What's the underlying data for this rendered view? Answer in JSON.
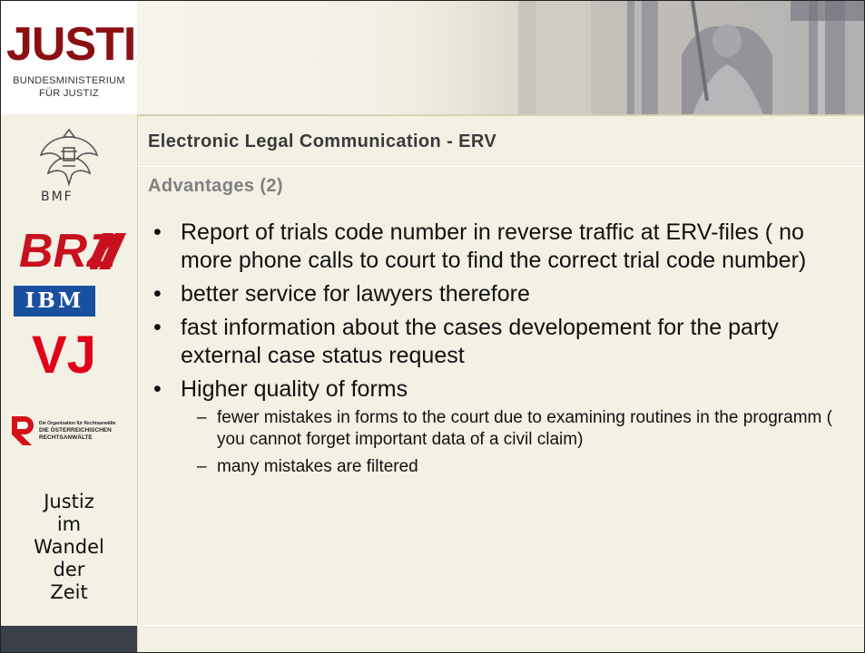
{
  "logos": {
    "justiz_wordmark": "JUSTIZ",
    "justiz_sub_line1": "BUNDESMINISTERIUM",
    "justiz_sub_line2": "FÜR JUSTIZ",
    "bmf_label": "BMF",
    "brz_label": "BRZ",
    "ibm_label": "IBM",
    "vj_label": "VJ",
    "rak_line1": "Die Organisation für Rechtsanwälte",
    "rak_line2": "DIE ÖSTERREICHISCHEN",
    "rak_line3": "RECHTSANWÄLTE"
  },
  "slide": {
    "title": "Electronic Legal Communication - ERV",
    "subtitle": "Advantages (2)",
    "bullets": [
      {
        "text": "Report of trials code number in reverse traffic at ERV-files ( no more phone calls to court to find the correct trial code number)"
      },
      {
        "text": "better service for lawyers therefore"
      },
      {
        "text": "fast information about the cases developement for the party external case status request"
      },
      {
        "text": "Higher quality of forms",
        "sub": [
          "fewer mistakes in forms to the court due to examining routines in the programm ( you cannot forget important data of a civil claim)",
          "many mistakes are filtered"
        ]
      }
    ],
    "bullet_glyph": "•",
    "dash_glyph": "–"
  },
  "motto": [
    "Justiz",
    "im",
    "Wandel",
    "der",
    "Zeit"
  ],
  "colors": {
    "justiz_red": "#8b1014",
    "brz_red": "#c8101e",
    "vj_red": "#e1001a",
    "ibm_blue": "#1a4fa0",
    "background": "#f3f0e4"
  }
}
